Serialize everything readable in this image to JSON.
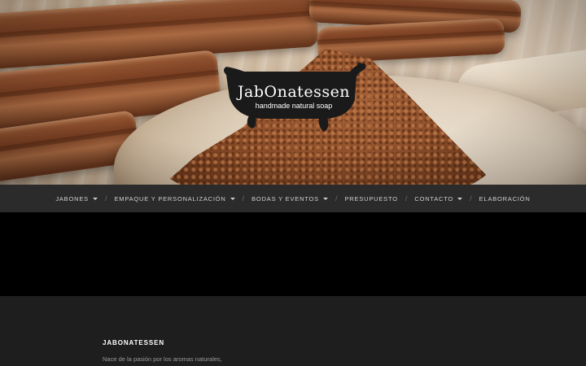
{
  "header": {
    "logo": {
      "title": "JabOnatessen",
      "subtitle": "handmade natural soap",
      "color": "#1a1a1a"
    }
  },
  "nav": {
    "items": [
      {
        "label": "JABONES",
        "has_dropdown": true
      },
      {
        "label": "EMPAQUE Y PERSONALIZACIÓN",
        "has_dropdown": true
      },
      {
        "label": "BODAS Y EVENTOS",
        "has_dropdown": true
      },
      {
        "label": "PRESUPUESTO",
        "has_dropdown": false
      },
      {
        "label": "CONTACTO",
        "has_dropdown": true
      },
      {
        "label": "ELABORACIÓN",
        "has_dropdown": false
      }
    ],
    "separator": "/",
    "background": "#2b2b2b"
  },
  "footer": {
    "title": "JABONATESSEN",
    "text": "Nace de la pasión por los aromas naturales,"
  }
}
